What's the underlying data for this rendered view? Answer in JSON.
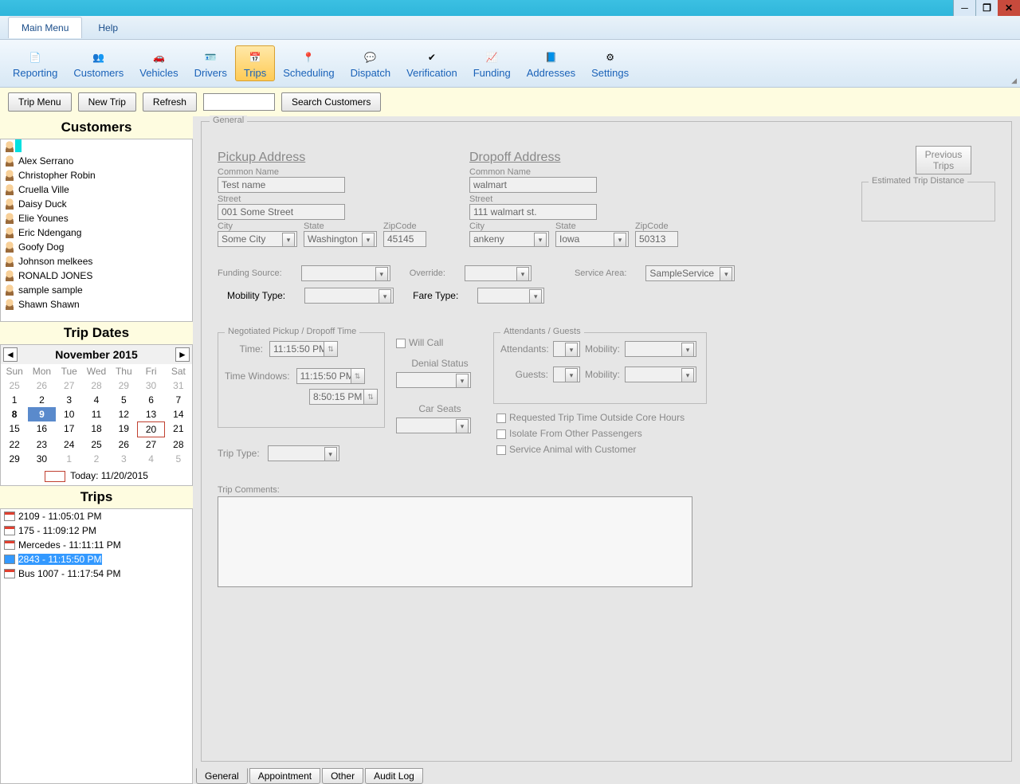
{
  "window": {
    "minimize": "─",
    "maximize": "❐",
    "close": "✕"
  },
  "menubar": {
    "main": "Main Menu",
    "help": "Help"
  },
  "toolbar": [
    {
      "label": "Reporting",
      "active": false
    },
    {
      "label": "Customers",
      "active": false
    },
    {
      "label": "Vehicles",
      "active": false
    },
    {
      "label": "Drivers",
      "active": false
    },
    {
      "label": "Trips",
      "active": true
    },
    {
      "label": "Scheduling",
      "active": false
    },
    {
      "label": "Dispatch",
      "active": false
    },
    {
      "label": "Verification",
      "active": false
    },
    {
      "label": "Funding",
      "active": false
    },
    {
      "label": "Addresses",
      "active": false
    },
    {
      "label": "Settings",
      "active": false
    }
  ],
  "subbar": {
    "trip_menu": "Trip Menu",
    "new_trip": "New Trip",
    "refresh": "Refresh",
    "search_customers": "Search Customers"
  },
  "sidebar": {
    "customers_title": "Customers",
    "customers": [
      "",
      "Alex Serrano",
      "Christopher Robin",
      "Cruella Ville",
      "Daisy Duck",
      "Elie  Younes",
      "Eric Ndengang",
      "Goofy Dog",
      "Johnson melkees",
      "RONALD JONES",
      "sample sample",
      "Shawn Shawn"
    ],
    "trip_dates_title": "Trip Dates",
    "calendar": {
      "title": "November 2015",
      "dow": [
        "Sun",
        "Mon",
        "Tue",
        "Wed",
        "Thu",
        "Fri",
        "Sat"
      ],
      "rows": [
        [
          {
            "d": "25",
            "o": true
          },
          {
            "d": "26",
            "o": true
          },
          {
            "d": "27",
            "o": true
          },
          {
            "d": "28",
            "o": true
          },
          {
            "d": "29",
            "o": true
          },
          {
            "d": "30",
            "o": true
          },
          {
            "d": "31",
            "o": true
          }
        ],
        [
          {
            "d": "1"
          },
          {
            "d": "2"
          },
          {
            "d": "3"
          },
          {
            "d": "4"
          },
          {
            "d": "5"
          },
          {
            "d": "6"
          },
          {
            "d": "7"
          }
        ],
        [
          {
            "d": "8",
            "b": true
          },
          {
            "d": "9",
            "b": true,
            "sel": true
          },
          {
            "d": "10"
          },
          {
            "d": "11"
          },
          {
            "d": "12"
          },
          {
            "d": "13"
          },
          {
            "d": "14"
          }
        ],
        [
          {
            "d": "15"
          },
          {
            "d": "16"
          },
          {
            "d": "17"
          },
          {
            "d": "18"
          },
          {
            "d": "19"
          },
          {
            "d": "20",
            "today": true
          },
          {
            "d": "21"
          }
        ],
        [
          {
            "d": "22"
          },
          {
            "d": "23"
          },
          {
            "d": "24"
          },
          {
            "d": "25"
          },
          {
            "d": "26"
          },
          {
            "d": "27"
          },
          {
            "d": "28"
          }
        ],
        [
          {
            "d": "29"
          },
          {
            "d": "30"
          },
          {
            "d": "1",
            "o": true
          },
          {
            "d": "2",
            "o": true
          },
          {
            "d": "3",
            "o": true
          },
          {
            "d": "4",
            "o": true
          },
          {
            "d": "5",
            "o": true
          }
        ]
      ],
      "today_label": "Today: 11/20/2015"
    },
    "trips_title": "Trips",
    "trips": [
      {
        "label": "2109 - 11:05:01 PM",
        "sel": false
      },
      {
        "label": "175 - 11:09:12 PM",
        "sel": false
      },
      {
        "label": "Mercedes - 11:11:11 PM",
        "sel": false
      },
      {
        "label": "2843 - 11:15:50 PM",
        "sel": true
      },
      {
        "label": "Bus 1007 - 11:17:54 PM",
        "sel": false
      }
    ]
  },
  "general": {
    "legend": "General",
    "pickup": {
      "title": "Pickup Address",
      "common_label": "Common Name",
      "common": "Test name",
      "street_label": "Street",
      "street": "001 Some Street",
      "city_label": "City",
      "city": "Some City",
      "state_label": "State",
      "state": "Washington",
      "zip_label": "ZipCode",
      "zip": "45145"
    },
    "dropoff": {
      "title": "Dropoff Address",
      "common_label": "Common Name",
      "common": "walmart",
      "street_label": "Street",
      "street": "111 walmart st.",
      "city_label": "City",
      "city": "ankeny",
      "state_label": "State",
      "state": "Iowa",
      "zip_label": "ZipCode",
      "zip": "50313"
    },
    "prev_trips_line1": "Previous",
    "prev_trips_line2": "Trips",
    "est_dist": "Estimated Trip Distance",
    "funding_source": "Funding Source:",
    "override": "Override:",
    "service_area": "Service Area:",
    "service_area_val": "SampleService",
    "mobility_type": "Mobility Type:",
    "fare_type": "Fare Type:",
    "nego": {
      "legend": "Negotiated  Pickup / Dropoff Time",
      "time_label": "Time:",
      "time": "11:15:50 PM",
      "tw_label": "Time Windows:",
      "tw1": "11:15:50 PM",
      "tw2": "8:50:15 PM"
    },
    "willcall": "Will Call",
    "denial": "Denial Status",
    "carseats": "Car Seats",
    "attend": {
      "legend": "Attendants / Guests",
      "attendants": "Attendants:",
      "guests": "Guests:",
      "mobility": "Mobility:"
    },
    "triptype": "Trip Type:",
    "chk1": "Requested Trip Time Outside Core Hours",
    "chk2": "Isolate From Other Passengers",
    "chk3": "Service Animal with Customer",
    "comments": "Trip Comments:"
  },
  "bottom_tabs": [
    "General",
    "Appointment",
    "Other",
    "Audit Log"
  ]
}
